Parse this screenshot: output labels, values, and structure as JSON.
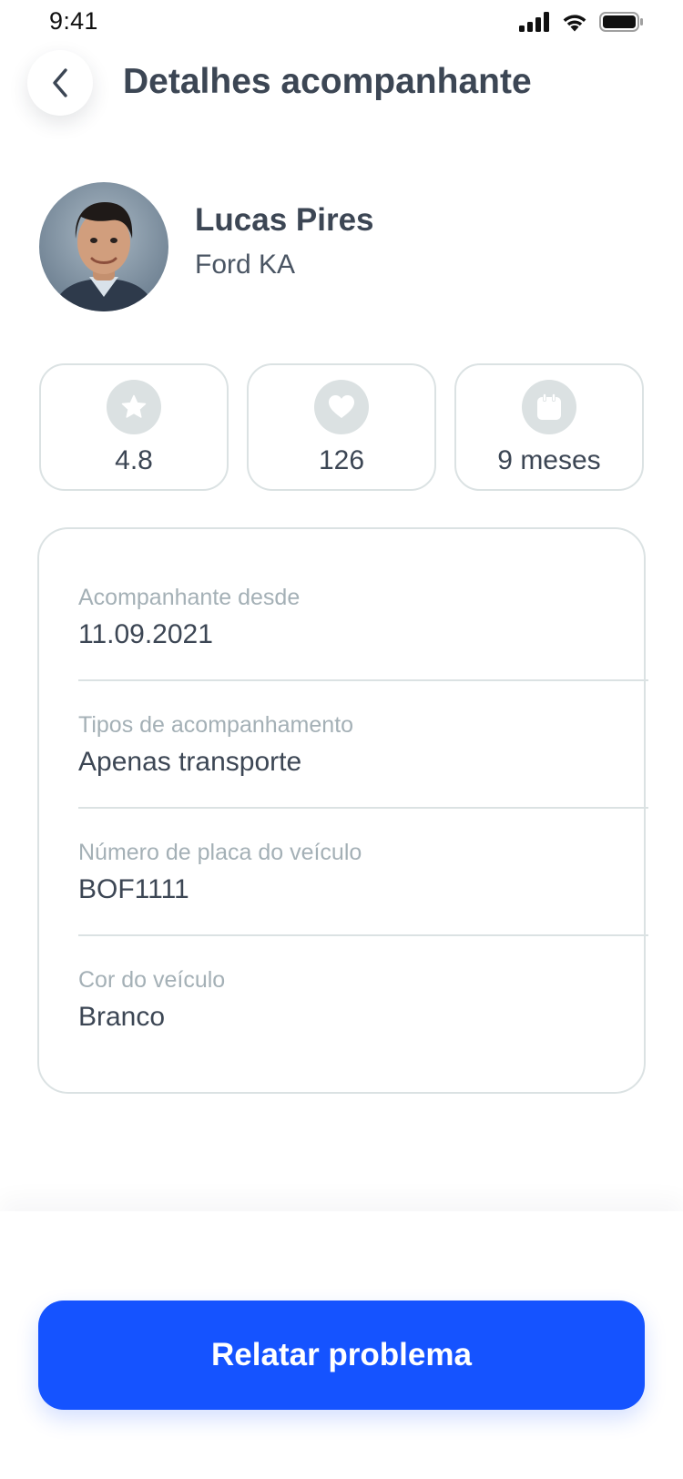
{
  "status_bar": {
    "time": "9:41",
    "icons": [
      "cellular-signal-icon",
      "wifi-icon",
      "battery-icon"
    ]
  },
  "header": {
    "back_icon": "chevron-left-icon",
    "title": "Detalhes acompanhante"
  },
  "profile": {
    "avatar": "avatar-photo",
    "name": "Lucas Pires",
    "vehicle": "Ford KA"
  },
  "stats": [
    {
      "icon": "star-icon",
      "value": "4.8"
    },
    {
      "icon": "heart-icon",
      "value": "126"
    },
    {
      "icon": "calendar-icon",
      "value": "9 meses"
    }
  ],
  "details": [
    {
      "label": "Acompanhante desde",
      "value": "11.09.2021"
    },
    {
      "label": "Tipos de acompanhamento",
      "value": "Apenas transporte"
    },
    {
      "label": "Número de placa do veículo",
      "value": "BOF1111"
    },
    {
      "label": "Cor do veículo",
      "value": "Branco"
    }
  ],
  "actions": {
    "report_label": "Relatar problema"
  },
  "colors": {
    "primary": "#1553FF",
    "text": "#3C4654",
    "muted": "#A4B0B6",
    "border": "#DBE2E3",
    "icon_background": "#DBE1E2"
  }
}
